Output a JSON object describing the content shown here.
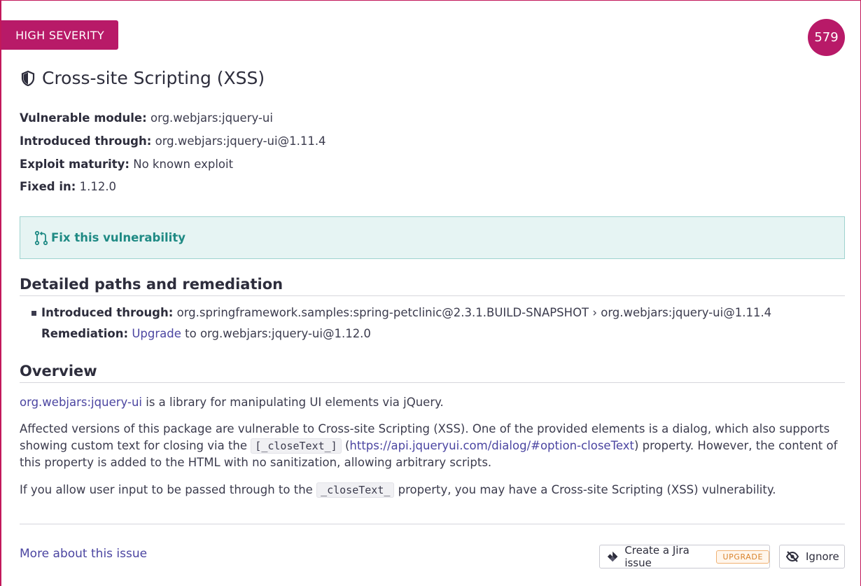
{
  "severity_badge": "HIGH SEVERITY",
  "score": "579",
  "title": "Cross-site Scripting (XSS)",
  "details": {
    "vulnerable_module_label": "Vulnerable module:",
    "vulnerable_module_value": "org.webjars:jquery-ui",
    "introduced_through_label": "Introduced through:",
    "introduced_through_value": "org.webjars:jquery-ui@1.11.4",
    "exploit_maturity_label": "Exploit maturity:",
    "exploit_maturity_value": "No known exploit",
    "fixed_in_label": "Fixed in:",
    "fixed_in_value": "1.12.0"
  },
  "fix_box": {
    "label": "Fix this vulnerability"
  },
  "paths_section": {
    "heading": "Detailed paths and remediation",
    "introduced_label": "Introduced through:",
    "introduced_value": "org.springframework.samples:spring-petclinic@2.3.1.BUILD-SNAPSHOT › org.webjars:jquery-ui@1.11.4",
    "remediation_label": "Remediation:",
    "remediation_link": "Upgrade",
    "remediation_rest": "to org.webjars:jquery-ui@1.12.0"
  },
  "overview": {
    "heading": "Overview",
    "p1_link": "org.webjars:jquery-ui",
    "p1_rest": "is a library for manipulating UI elements via jQuery.",
    "p2_part1": "Affected versions of this package are vulnerable to Cross-site Scripting (XSS). One of the provided elements is a dialog, which also supports showing custom text for closing via the",
    "p2_code": "[_closeText_]",
    "p2_link": "https://api.jqueryui.com/dialog/#option-closeText",
    "p2_part2": "property. However, the content of this property is added to the HTML with no sanitization, allowing arbitrary scripts.",
    "p3_part1": "If you allow user input to be passed through to the",
    "p3_code": "_closeText_",
    "p3_part2": "property, you may have a Cross-site Scripting (XSS) vulnerability."
  },
  "footer": {
    "more_link": "More about this issue",
    "jira_button": "Create a Jira issue",
    "upgrade_tag": "UPGRADE",
    "ignore_button": "Ignore"
  },
  "colors": {
    "severity": "#b81a68",
    "link": "#4b45a1",
    "fix_text": "#1f8a84",
    "fix_bg": "#e6f4f3"
  },
  "icons": {
    "title_icon": "shield-icon",
    "fix_icon": "git-merge-icon",
    "jira_icon": "jira-icon",
    "ignore_icon": "eye-off-icon"
  }
}
